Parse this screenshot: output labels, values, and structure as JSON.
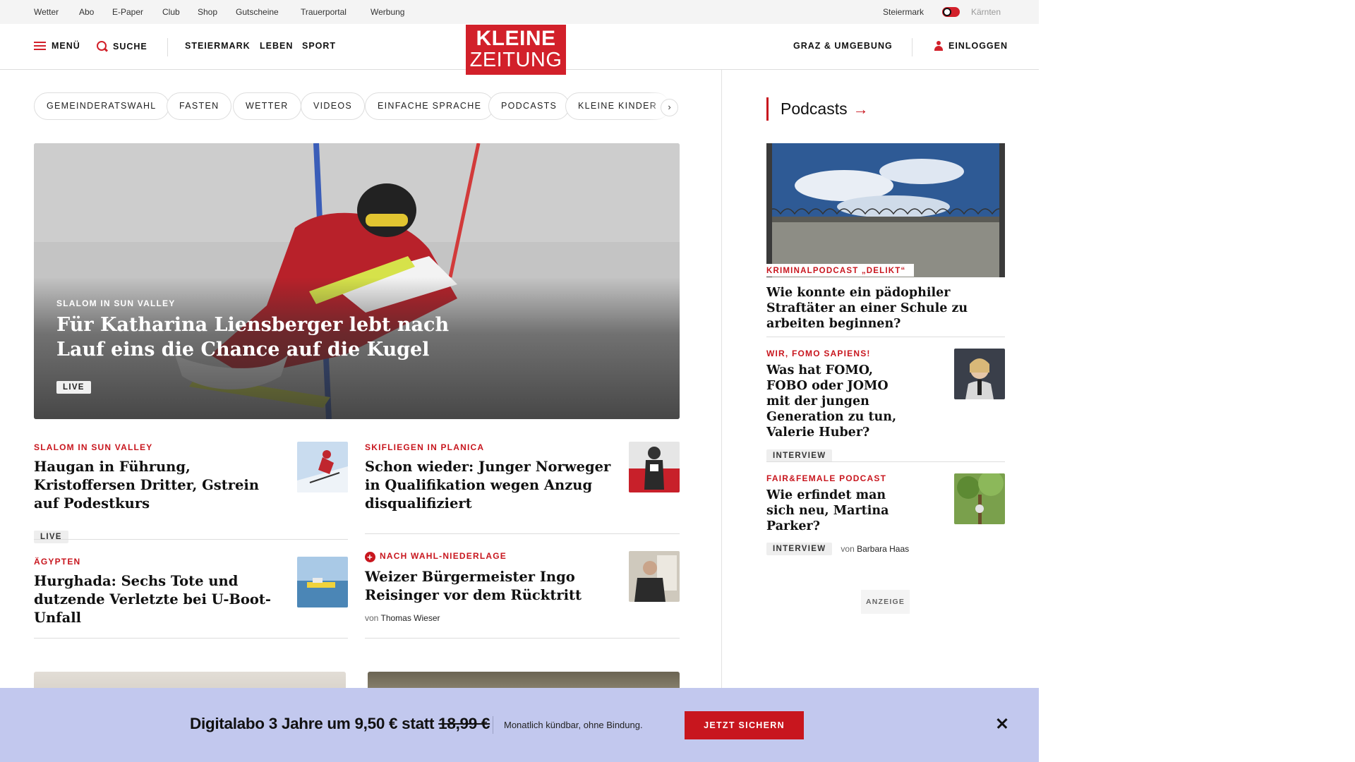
{
  "topbar": {
    "links": [
      "Wetter",
      "Abo",
      "E-Paper",
      "Club",
      "Shop",
      "Gutscheine",
      "Trauerportal",
      "Werbung"
    ],
    "region_active": "Steiermark",
    "region_inactive": "Kärnten"
  },
  "header": {
    "menu": "MENÜ",
    "search": "SUCHE",
    "nav": [
      "STEIERMARK",
      "LEBEN",
      "SPORT"
    ],
    "logo_line1": "KLEINE",
    "logo_line2": "ZEITUNG",
    "location": "GRAZ & UMGEBUNG",
    "login": "EINLOGGEN"
  },
  "chips": [
    "GEMEINDERATSWAHL",
    "FASTEN",
    "WETTER",
    "VIDEOS",
    "EINFACHE SPRACHE",
    "PODCASTS",
    "KLEINE KINDER"
  ],
  "chip_next": "›",
  "hero": {
    "kicker": "SLALOM IN SUN VALLEY",
    "title": "Für Katharina Liensberger lebt nach Lauf eins die Chance auf die Kugel",
    "badge": "LIVE"
  },
  "articles": [
    {
      "kicker": "SLALOM IN SUN VALLEY",
      "title": "Haugan in Führung, Kristoffersen Dritter, Gstrein auf Podestkurs",
      "badge": "LIVE"
    },
    {
      "kicker": "SKIFLIEGEN IN PLANICA",
      "title": "Schon wieder: Junger Norweger in Qualifikation wegen Anzug disqualifiziert"
    },
    {
      "kicker": "ÄGYPTEN",
      "title": "Hurghada: Sechs Tote und dutzende Verletzte bei U-Boot-Unfall"
    },
    {
      "kicker": "NACH WAHL-NIEDERLAGE",
      "title": "Weizer Bürgermeister Ingo Reisinger vor dem Rücktritt",
      "byline_prefix": "von",
      "author": "Thomas Wieser"
    }
  ],
  "sidebar": {
    "title": "Podcasts",
    "arrow": "→",
    "feature": {
      "tag": "KRIMINALPODCAST „DELIKT“",
      "title": "Wie konnte ein pädophiler Straftäter an einer Schule zu arbeiten beginnen?"
    },
    "items": [
      {
        "kicker": "WIR, FOMO SAPIENS!",
        "title": "Was hat FOMO, FOBO oder JOMO mit der jungen Generation zu tun, Valerie Huber?",
        "badge": "INTERVIEW"
      },
      {
        "kicker": "FAIR&FEMALE PODCAST",
        "title": "Wie erfindet man sich neu, Martina Parker?",
        "badge": "INTERVIEW",
        "byline_prefix": "von",
        "author": "Barbara Haas"
      }
    ],
    "ad_label": "ANZEIGE"
  },
  "banner": {
    "main_text": "Digitalabo 3 Jahre um 9,50 € statt",
    "old_price": "18,99 €",
    "sub_text": "Monatlich kündbar, ohne Bindung.",
    "cta": "JETZT SICHERN"
  },
  "colors": {
    "brand_red": "#d2202a",
    "kicker_red": "#c8161e",
    "banner_bg": "#c2c8ee",
    "topbar_bg": "#f4f4f4"
  },
  "icons": {
    "menu": "hamburger-icon",
    "search": "search-icon",
    "login": "user-icon",
    "close": "close-icon",
    "add": "plus-circle-icon"
  }
}
